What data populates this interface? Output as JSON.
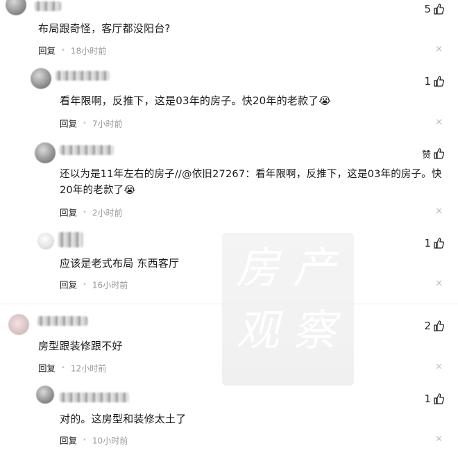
{
  "reply_label": "回复",
  "comments": [
    {
      "text": "布局跟奇怪，客厅都没阳台?",
      "time": "18小时前",
      "likes": "5"
    },
    {
      "text": "看年限啊，反推下，这是03年的房子。快20年的老款了",
      "emoji": "😭",
      "time": "7小时前",
      "likes": "1"
    },
    {
      "text_line1": "还以为是11年左右的房子//@依旧27267：看年限啊，反推下，这是03年的房子。快",
      "text_line2": "20年的老款了",
      "emoji": "😭",
      "time": "2小时前",
      "likes": "赞"
    },
    {
      "text": "应该是老式布局 东西客厅",
      "time": "16小时前",
      "likes": "1"
    },
    {
      "text": "房型跟装修跟不好",
      "time": "12小时前",
      "likes": "2"
    },
    {
      "text": "对的。这房型和装修太土了",
      "time": "10小时前",
      "likes": "1"
    }
  ],
  "watermark": {
    "line1": "房 产",
    "line2": "观 察"
  },
  "icons": {
    "like": "thumbs-up-icon",
    "close": "close-icon"
  }
}
